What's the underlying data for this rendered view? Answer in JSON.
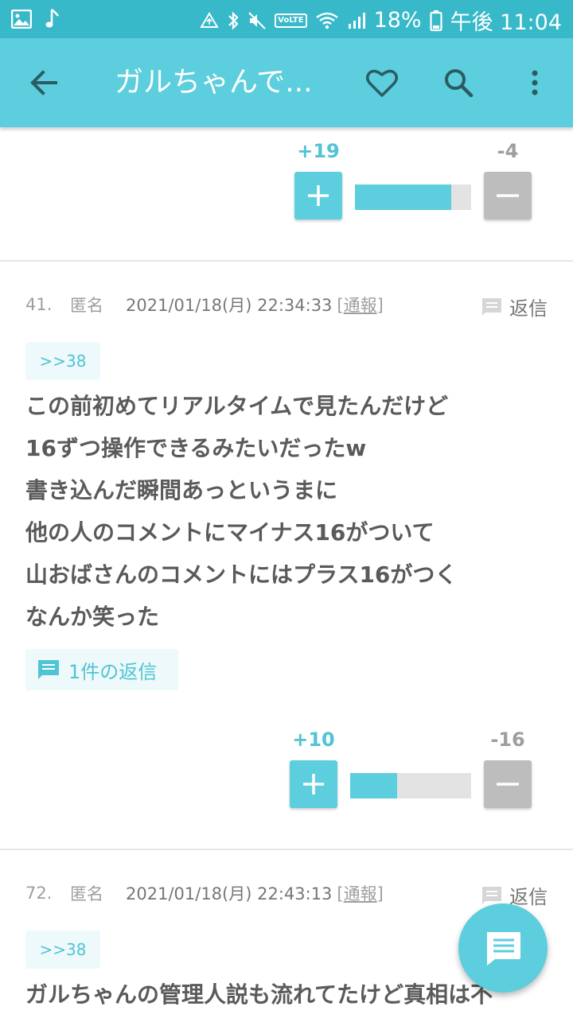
{
  "status_bar": {
    "battery": "18%",
    "time": "午後 11:04",
    "volte": "VoLTE"
  },
  "app_bar": {
    "title": "ガルちゃんで..."
  },
  "top_vote": {
    "plus": "+19",
    "minus": "-4",
    "ratio": 0.83
  },
  "comments": [
    {
      "number": "41.",
      "author": "匿名",
      "date": "2021/01/18(月) 22:34:33",
      "report_open": "[",
      "report": "通報",
      "report_close": "]",
      "reply_label": "返信",
      "anchor": ">>38",
      "lines": [
        "この前初めてリアルタイムで見たんだけど",
        "16ずつ操作できるみたいだったw",
        "書き込んだ瞬間あっというまに",
        "他の人のコメントにマイナス16がついて",
        "山おばさんのコメントにはプラス16がつく",
        "なんか笑った"
      ],
      "replies_label": "1件の返信",
      "vote": {
        "plus": "+10",
        "minus": "-16",
        "ratio": 0.39
      }
    },
    {
      "number": "72.",
      "author": "匿名",
      "date": "2021/01/18(月) 22:43:13",
      "report_open": "[",
      "report": "通報",
      "report_close": "]",
      "reply_label": "返信",
      "anchor": ">>38",
      "lines": [
        "ガルちゃんの管理人説も流れてたけど真相は不"
      ]
    }
  ],
  "colors": {
    "accent": "#5ccedd",
    "status_bar": "#37b9c9",
    "minus_button": "#bdbdbd",
    "text": "#5a5a5a"
  },
  "icons": [
    "gallery-icon",
    "music-note-icon",
    "data-sync-icon",
    "bluetooth-icon",
    "mute-icon",
    "wifi-icon",
    "signal-icon",
    "battery-icon",
    "back-arrow-icon",
    "heart-icon",
    "search-icon",
    "more-vert-icon",
    "comment-icon",
    "chat-icon"
  ]
}
